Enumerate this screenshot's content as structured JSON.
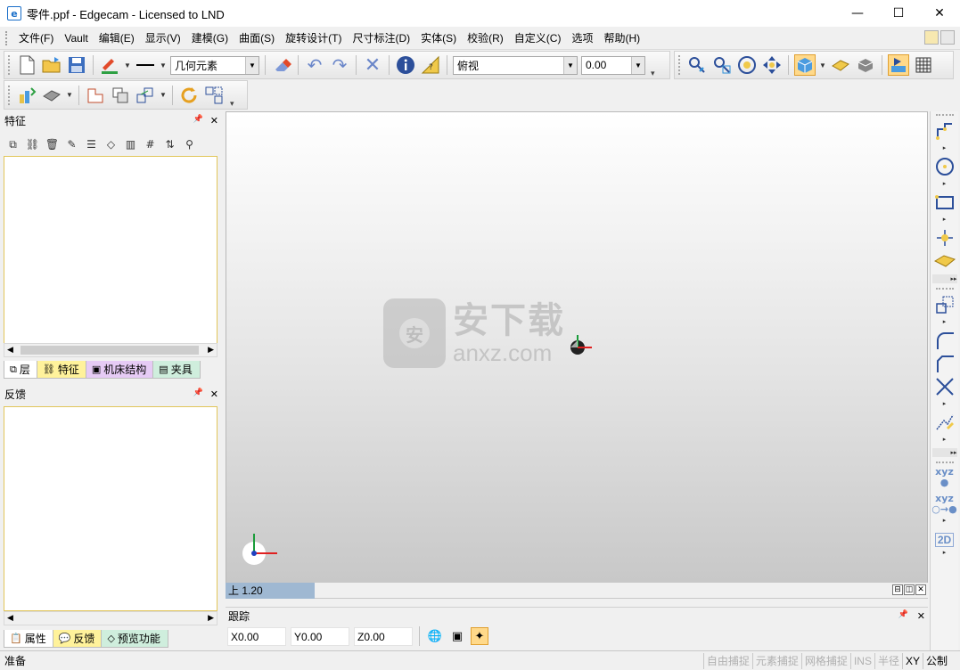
{
  "window": {
    "title": "零件.ppf - Edgecam - Licensed to LND",
    "minimize_glyph": "—",
    "maximize_glyph": "☐",
    "close_glyph": "✕"
  },
  "menu": {
    "items": [
      "文件(F)",
      "Vault",
      "编辑(E)",
      "显示(V)",
      "建模(G)",
      "曲面(S)",
      "旋转设计(T)",
      "尺寸标注(D)",
      "实体(S)",
      "校验(R)",
      "自定义(C)",
      "选项",
      "帮助(H)"
    ]
  },
  "toolbar": {
    "entity_type": "几何元素",
    "view": "俯视",
    "value": "0.00"
  },
  "features_panel": {
    "title": "特征",
    "pin_glyph": "📌",
    "close_glyph": "✕",
    "tabs": [
      "层",
      "特征",
      "机床结构",
      "夹具"
    ]
  },
  "feedback_panel": {
    "title": "反馈",
    "pin_glyph": "📌",
    "close_glyph": "✕",
    "tabs": [
      "属性",
      "反馈",
      "预览功能"
    ]
  },
  "viewport": {
    "view_label": "上 1.20",
    "watermark_cn": "安下载",
    "watermark_en": "anxz.com",
    "watermark_shield": "安"
  },
  "trace": {
    "title": "跟踪",
    "x": "X0.00",
    "y": "Y0.00",
    "z": "Z0.00"
  },
  "right_toolbar": {
    "xyz1": "xyz",
    "xyz2": "xyz",
    "twod": "2D"
  },
  "status": {
    "text": "准备",
    "cells": [
      "自由捕捉",
      "元素捕捉",
      "网格捕捉",
      "INS",
      "半径",
      "XY",
      "公制"
    ]
  },
  "colors": {
    "accent": "#e0a030",
    "viewport_top": "#ffffff",
    "viewport_bottom": "#c8c8c8",
    "view_label_bg": "#9fb8d2",
    "panel_border": "#e2c65a"
  }
}
